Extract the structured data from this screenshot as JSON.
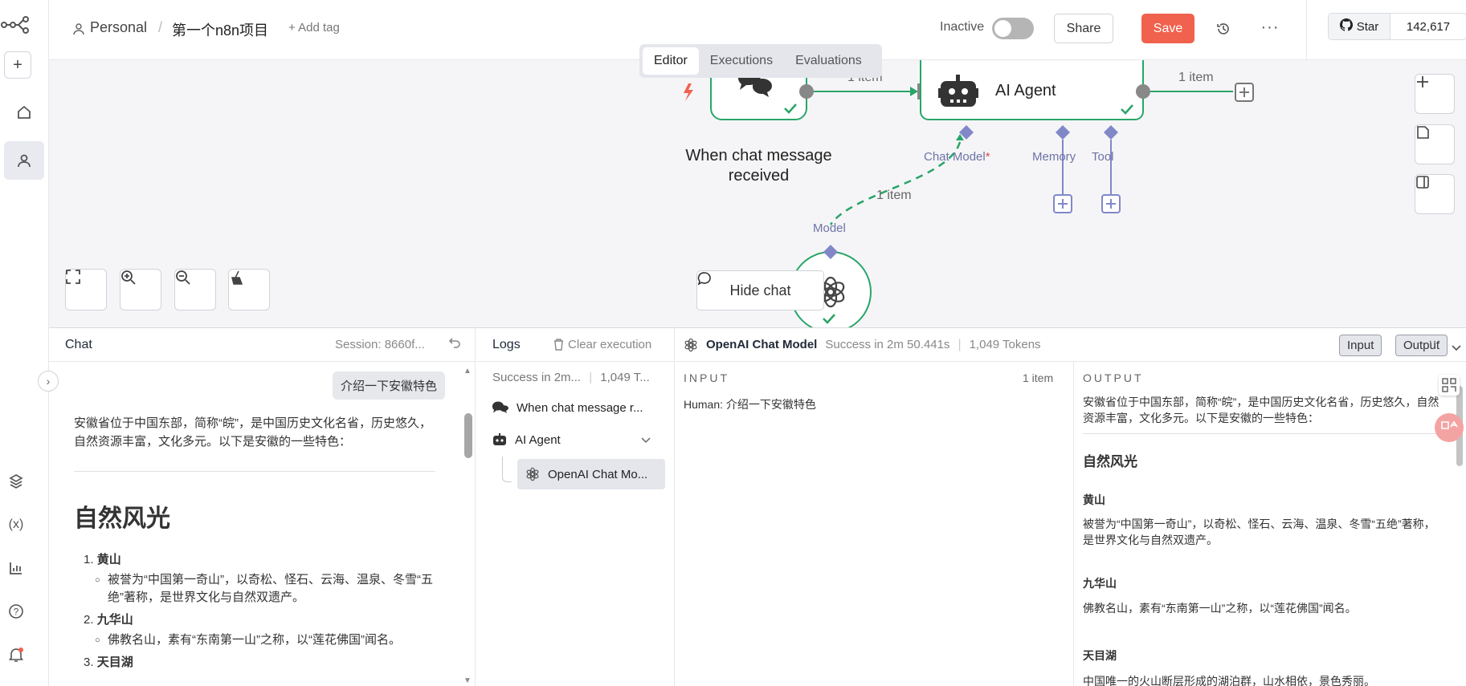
{
  "app": {
    "breadcrumb_workspace": "Personal",
    "breadcrumb_sep": "/",
    "project_name": "第一个n8n项目",
    "add_tag": "+ Add tag",
    "status_label": "Inactive",
    "share_label": "Share",
    "save_label": "Save",
    "more_label": "···",
    "github_star": "Star",
    "github_count": "142,617"
  },
  "mode_tabs": [
    "Editor",
    "Executions",
    "Evaluations"
  ],
  "canvas": {
    "trigger_node_label": "When chat message received",
    "agent_node_label": "AI Agent",
    "edge_label_1": "1 item",
    "edge_label_2": "1 item",
    "edge_label_3": "1 item",
    "port_chat_model": "Chat Model",
    "port_required_mark": "*",
    "port_memory": "Memory",
    "port_tool": "Tool",
    "port_model": "Model",
    "hide_chat_label": "Hide chat"
  },
  "chat": {
    "title": "Chat",
    "session": "Session: 8660f...",
    "user_message": "介绍一下安徽特色",
    "bot_intro": "安徽省位于中国东部，简称“皖”，是中国历史文化名省，历史悠久，自然资源丰富，文化多元。以下是安徽的一些特色：",
    "bot_heading": "自然风光",
    "items": [
      {
        "num": "1.",
        "title": "黄山",
        "desc": "被誉为“中国第一奇山”，以奇松、怪石、云海、温泉、冬雪“五绝”著称，是世界文化与自然双遗产。"
      },
      {
        "num": "2.",
        "title": "九华山",
        "desc": "佛教名山，素有“东南第一山”之称，以“莲花佛国”闻名。"
      },
      {
        "num": "3.",
        "title": "天目湖",
        "desc": ""
      }
    ]
  },
  "logs": {
    "title": "Logs",
    "clear_label": "Clear execution",
    "meta_status": "Success in 2m...",
    "meta_tokens": "1,049 T...",
    "items": [
      {
        "label": "When chat message r..."
      },
      {
        "label": "AI Agent"
      },
      {
        "label": "OpenAI Chat Mo..."
      }
    ]
  },
  "io": {
    "node_name": "OpenAI Chat Model",
    "status": "Success in 2m 50.441s",
    "tokens": "1,049 Tokens",
    "input_btn": "Input",
    "output_btn": "Output",
    "input_head": "INPUT",
    "input_count": "1 item",
    "input_text": "Human: 介绍一下安徽特色",
    "output_head": "OUTPUT",
    "output_intro": "安徽省位于中国东部，简称“皖”，是中国历史文化名省，历史悠久，自然资源丰富，文化多元。以下是安徽的一些特色：",
    "output_heading": "自然风光",
    "out_items": [
      {
        "title": "黄山",
        "desc": "被誉为“中国第一奇山”，以奇松、怪石、云海、温泉、冬雪“五绝”著称，是世界文化与自然双遗产。"
      },
      {
        "title": "九华山",
        "desc": "佛教名山，素有“东南第一山”之称，以“莲花佛国”闻名。"
      },
      {
        "title": "天目湖",
        "desc": "中国唯一的火山断层形成的湖泊群，山水相依，景色秀丽。"
      }
    ]
  },
  "colors": {
    "accent": "#f0624d",
    "success": "#29a568",
    "port": "#8188c8"
  }
}
